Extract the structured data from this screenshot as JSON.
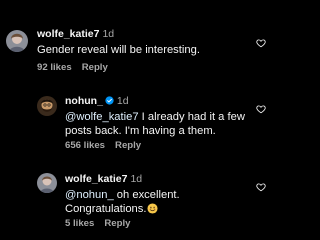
{
  "comments": [
    {
      "username": "wolfe_katie7",
      "time": "1d",
      "text": "Gender reveal will be interesting.",
      "likes": "92 likes",
      "reply": "Reply"
    },
    {
      "username": "nohun_",
      "verified": true,
      "time": "1d",
      "mention": "@wolfe_katie7",
      "text": " I already had it a few posts back. I'm having a them.",
      "likes": "656 likes",
      "reply": "Reply"
    },
    {
      "username": "wolfe_katie7",
      "time": "1d",
      "mention": "@nohun_",
      "text": " oh excellent. Congratulations.",
      "emoji": "smiling-face-emoji",
      "likes": "5 likes",
      "reply": "Reply"
    }
  ],
  "colors": {
    "background": "#000000",
    "primary_text": "#f5f5f5",
    "secondary_text": "#a8a8a8",
    "mention": "#e0f1ff",
    "verified_badge": "#0095f6"
  },
  "icons": {
    "like": "heart-outline-icon",
    "verified": "verified-badge-icon"
  }
}
